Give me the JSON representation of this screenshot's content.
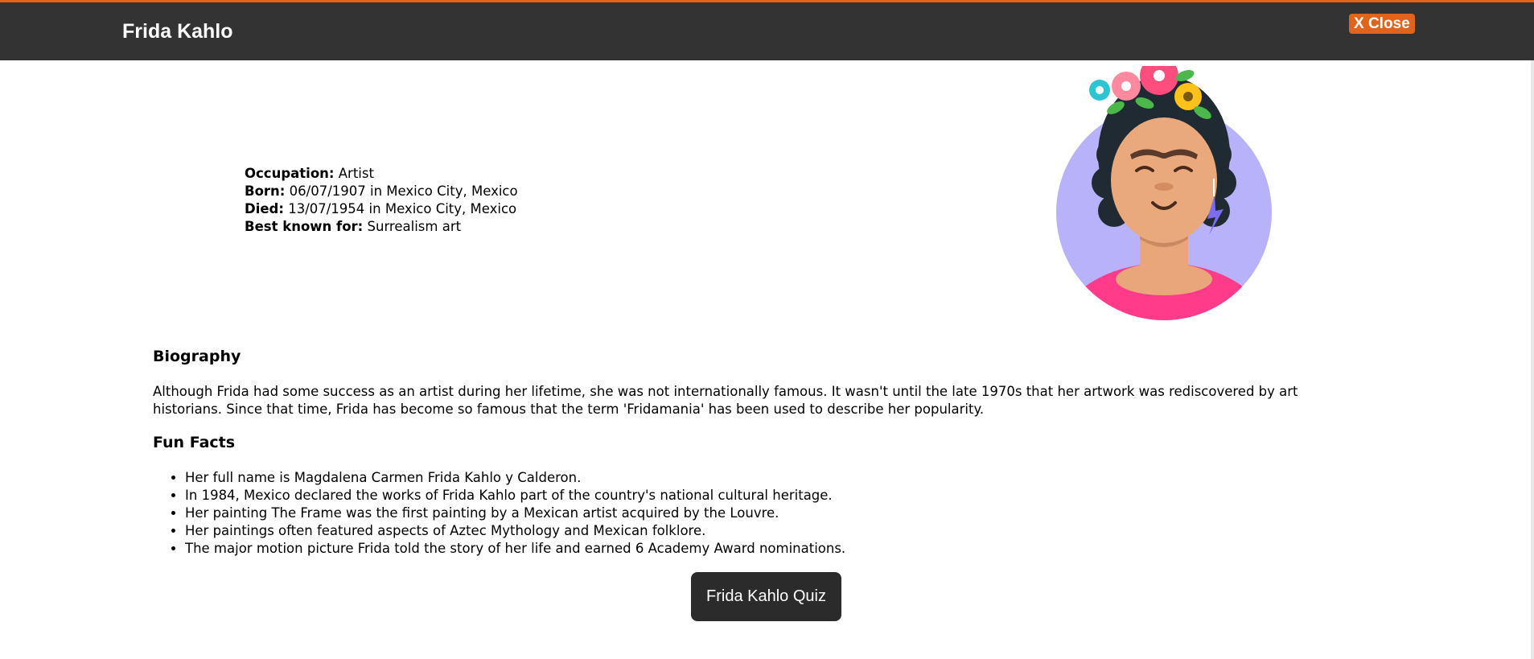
{
  "header": {
    "title": "Frida Kahlo",
    "close_label": "X Close"
  },
  "profile": {
    "occupation_label": "Occupation:",
    "occupation_value": " Artist",
    "born_label": "Born:",
    "born_value": " 06/07/1907 in Mexico City, Mexico",
    "died_label": "Died:",
    "died_value": " 13/07/1954 in Mexico City, Mexico",
    "known_label": "Best known for:",
    "known_value": " Surrealism art",
    "avatar_icon": "frida-kahlo-portrait-icon"
  },
  "biography": {
    "heading": "Biography",
    "text": "Although Frida had some success as an artist during her lifetime, she was not internationally famous. It wasn't until the late 1970s that her artwork was rediscovered by art historians. Since that time, Frida has become so famous that the term 'Fridamania' has been used to describe her popularity."
  },
  "fun_facts": {
    "heading": "Fun Facts",
    "items": [
      "Her full name is Magdalena Carmen Frida Kahlo y Calderon.",
      "In 1984, Mexico declared the works of Frida Kahlo part of the country's national cultural heritage.",
      "Her painting The Frame was the first painting by a Mexican artist acquired by the Louvre.",
      "Her paintings often featured aspects of Aztec Mythology and Mexican folklore.",
      "The major motion picture Frida told the story of her life and earned 6 Academy Award nominations."
    ]
  },
  "quiz": {
    "label": "Frida Kahlo Quiz"
  },
  "colors": {
    "header_bg": "#333333",
    "accent": "#e0641c",
    "button_bg": "#2b2b2b",
    "avatar_circle": "#b8b2fb",
    "shirt": "#ff3b8a"
  }
}
